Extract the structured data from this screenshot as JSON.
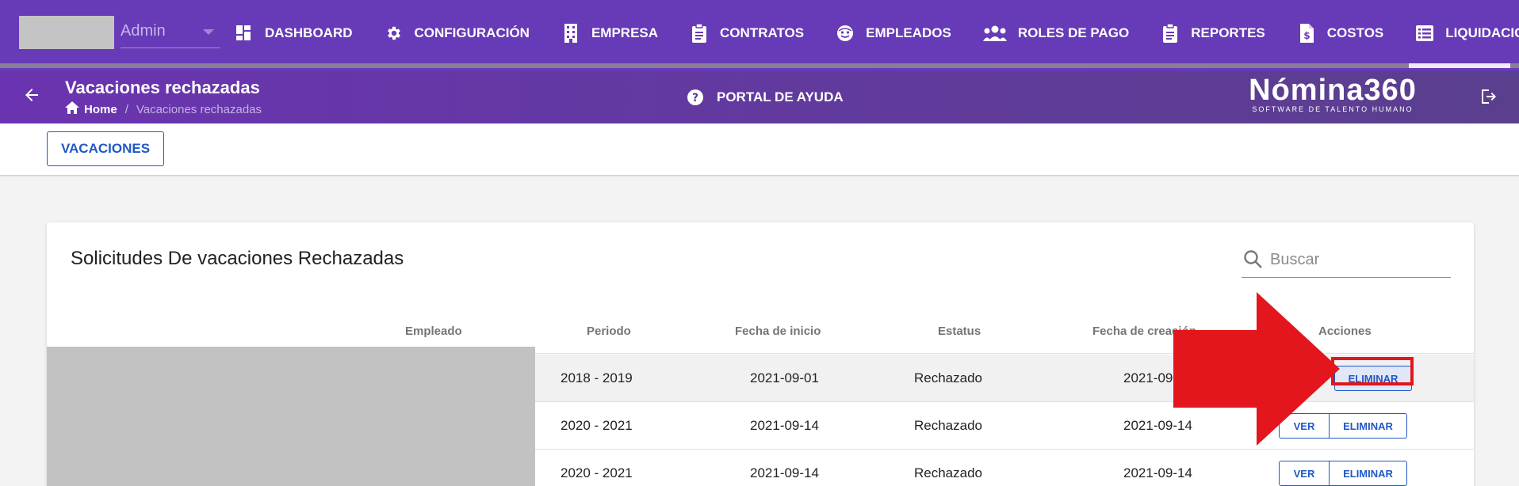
{
  "user": {
    "name": "Admin"
  },
  "nav": {
    "items": [
      {
        "label": "DASHBOARD",
        "icon": "dashboard-icon"
      },
      {
        "label": "CONFIGURACIÓN",
        "icon": "gear-icon"
      },
      {
        "label": "EMPRESA",
        "icon": "building-icon"
      },
      {
        "label": "CONTRATOS",
        "icon": "clipboard-icon"
      },
      {
        "label": "EMPLEADOS",
        "icon": "face-icon"
      },
      {
        "label": "ROLES DE PAGO",
        "icon": "people-icon"
      },
      {
        "label": "REPORTES",
        "icon": "clipboard-icon"
      },
      {
        "label": "COSTOS",
        "icon": "invoice-dollar-icon"
      },
      {
        "label": "LIQUIDACIONES",
        "icon": "list-icon"
      }
    ]
  },
  "header": {
    "title": "Vacaciones rechazadas",
    "breadcrumb": {
      "home": "Home",
      "separator": "/",
      "current": "Vacaciones rechazadas"
    },
    "help_label": "PORTAL DE AYUDA",
    "brand_name": "Nómina360",
    "brand_tagline": "SOFTWARE DE TALENTO HUMANO"
  },
  "tabs": {
    "vacaciones": "VACACIONES"
  },
  "card": {
    "title": "Solicitudes De vacaciones Rechazadas",
    "search_placeholder": "Buscar"
  },
  "table": {
    "columns": [
      "Empleado",
      "Periodo",
      "Fecha de inicio",
      "Estatus",
      "Fecha de creación",
      "Acciones"
    ],
    "rows": [
      {
        "periodo": "2018 - 2019",
        "fecha_inicio": "2021-09-01",
        "estatus": "Rechazado",
        "fecha_creacion": "2021-09",
        "actions": [
          "ELIMINAR"
        ]
      },
      {
        "periodo": "2020 - 2021",
        "fecha_inicio": "2021-09-14",
        "estatus": "Rechazado",
        "fecha_creacion": "2021-09-14",
        "actions": [
          "VER",
          "ELIMINAR"
        ]
      },
      {
        "periodo": "2020 - 2021",
        "fecha_inicio": "2021-09-14",
        "estatus": "Rechazado",
        "fecha_creacion": "2021-09-14",
        "actions": [
          "VER",
          "ELIMINAR"
        ]
      }
    ]
  },
  "colors": {
    "nav_bg": "#673ab7",
    "accent_blue": "#1f58c6",
    "annotation_red": "#e3161d"
  }
}
